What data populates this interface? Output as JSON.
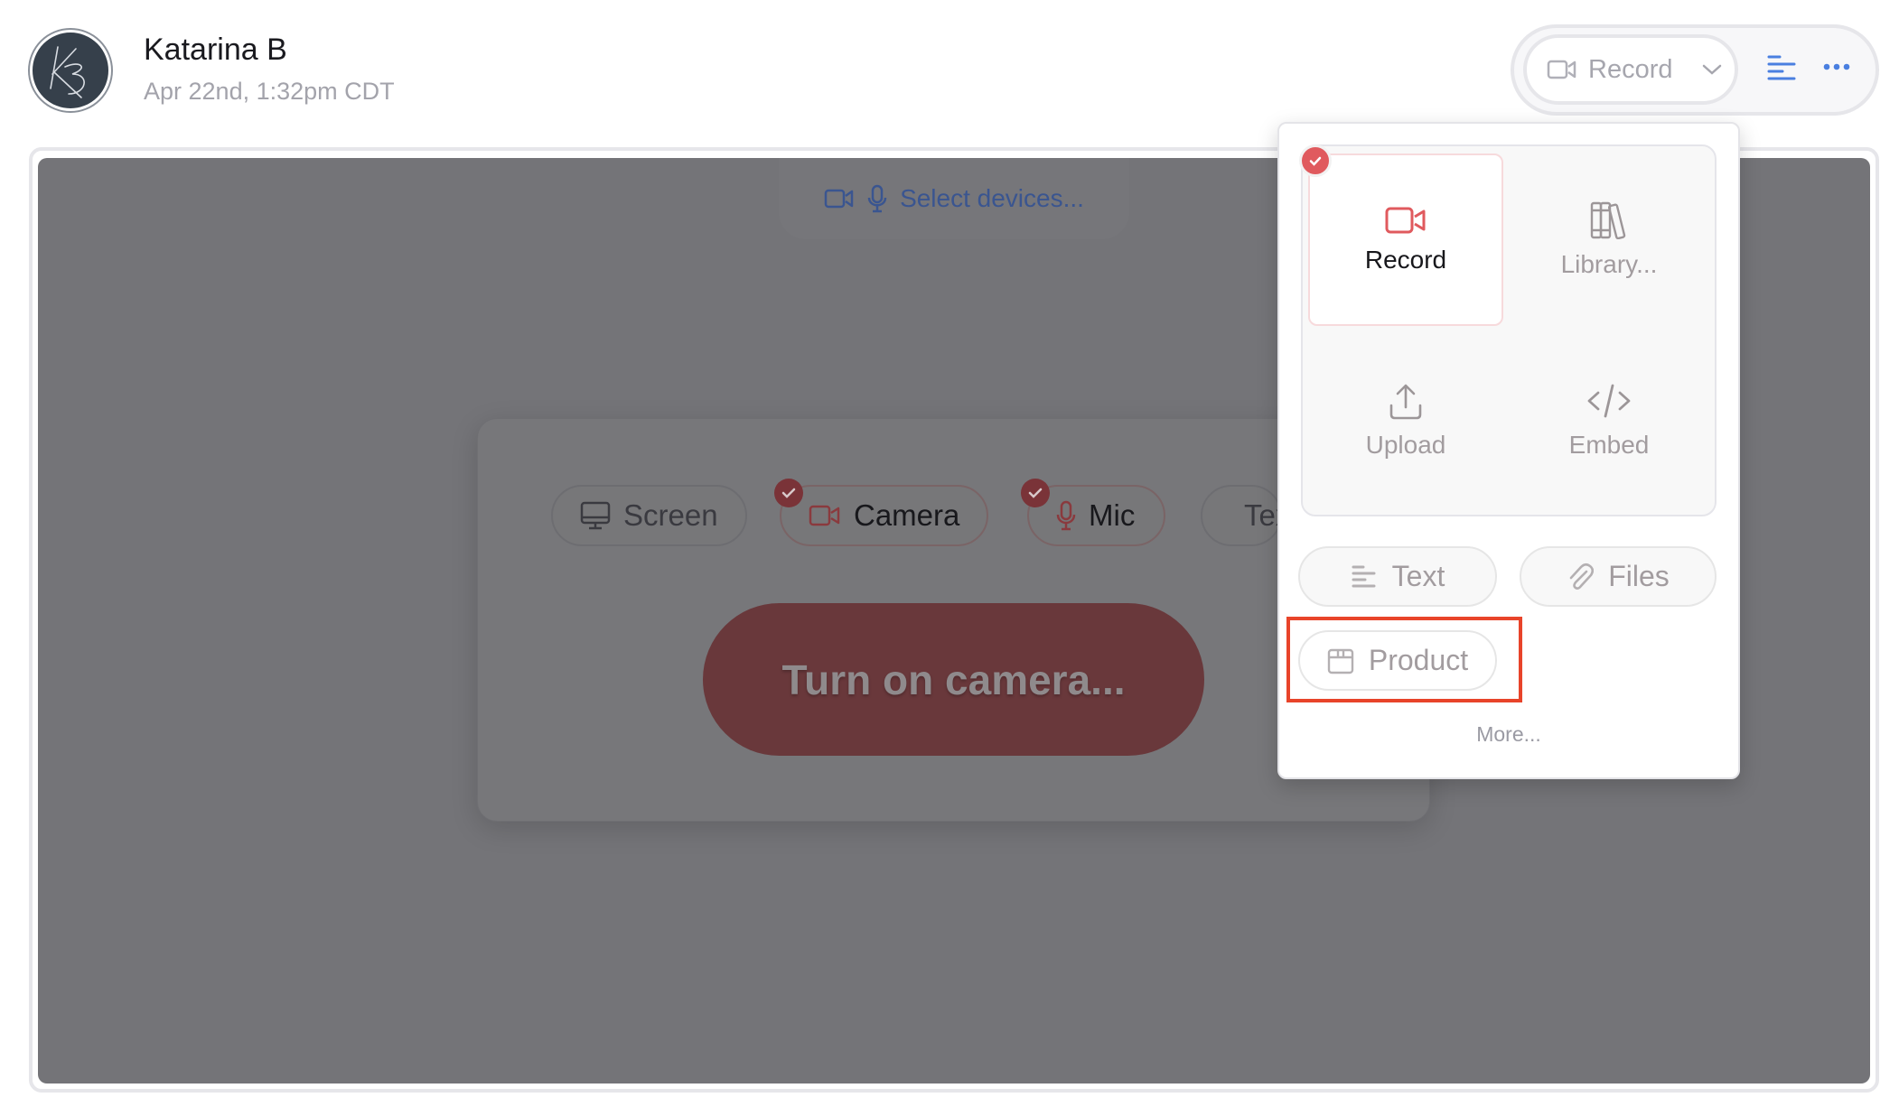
{
  "header": {
    "user_name": "Katarina B",
    "timestamp": "Apr 22nd, 1:32pm CDT",
    "avatar_initials": "KB"
  },
  "toolbar": {
    "record_label": "Record",
    "record_icon": "video-camera-icon",
    "dropdown_icon": "chevron-down-icon",
    "text_icon": "text-lines-icon",
    "more_icon": "more-horizontal-icon"
  },
  "stage": {
    "select_devices_label": "Select devices...",
    "sources": [
      {
        "label": "Screen",
        "icon": "monitor-icon",
        "selected": false
      },
      {
        "label": "Camera",
        "icon": "video-camera-icon",
        "selected": true
      },
      {
        "label": "Mic",
        "icon": "microphone-icon",
        "selected": true
      },
      {
        "label": "Text",
        "icon": "text-lines-icon",
        "selected": false
      }
    ],
    "turn_on_label": "Turn on camera..."
  },
  "popup": {
    "tiles": [
      {
        "label": "Record",
        "icon": "video-camera-icon",
        "selected": true
      },
      {
        "label": "Library...",
        "icon": "books-icon",
        "selected": false
      },
      {
        "label": "Upload",
        "icon": "upload-icon",
        "selected": false
      },
      {
        "label": "Embed",
        "icon": "code-icon",
        "selected": false
      }
    ],
    "pills": [
      {
        "label": "Text",
        "icon": "text-lines-icon"
      },
      {
        "label": "Files",
        "icon": "paperclip-icon"
      },
      {
        "label": "Product",
        "icon": "product-box-icon"
      }
    ],
    "more_label": "More..."
  },
  "colors": {
    "accent_red": "#e05a5e",
    "accent_blue": "#4a7fe0",
    "highlight": "#e8442a"
  }
}
